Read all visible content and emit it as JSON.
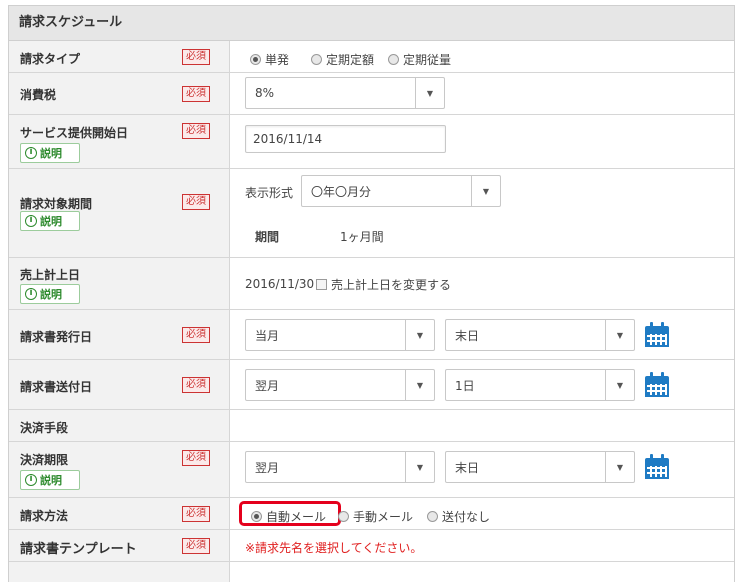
{
  "section_title": "請求スケジュール",
  "required_label": "必須",
  "info_label": "説明",
  "info_icon_glyph": "i",
  "rows": {
    "billing_type": {
      "label": "請求タイプ",
      "options": [
        "単発",
        "定期定額",
        "定期従量"
      ],
      "selected": "単発"
    },
    "tax": {
      "label": "消費税",
      "value": "8%"
    },
    "service_start": {
      "label": "サービス提供開始日",
      "value": "2016/11/14"
    },
    "billing_period": {
      "label": "請求対象期間",
      "format_label": "表示形式",
      "format_value": "〇年〇月分",
      "period_label": "期間",
      "period_value": "1ヶ月間"
    },
    "sales_date": {
      "label": "売上計上日",
      "value": "2016/11/30",
      "checkbox_label": "売上計上日を変更する"
    },
    "invoice_issue": {
      "label": "請求書発行日",
      "month": "当月",
      "day": "末日"
    },
    "invoice_send": {
      "label": "請求書送付日",
      "month": "翌月",
      "day": "1日"
    },
    "payment_method": {
      "label": "決済手段"
    },
    "payment_due": {
      "label": "決済期限",
      "month": "翌月",
      "day": "末日"
    },
    "billing_method": {
      "label": "請求方法",
      "options": [
        "自動メール",
        "手動メール",
        "送付なし"
      ],
      "selected": "自動メール"
    },
    "invoice_template": {
      "label": "請求書テンプレート",
      "warning": "※請求先名を選択してください。"
    }
  },
  "colors": {
    "required": "#cc3333",
    "info": "#2e8b2e",
    "calendar": "#1f7bc4",
    "highlight": "#e4001c",
    "warning": "#e02020"
  },
  "icons": {
    "select_arrow": "▼",
    "calendar": "calendar-icon"
  }
}
